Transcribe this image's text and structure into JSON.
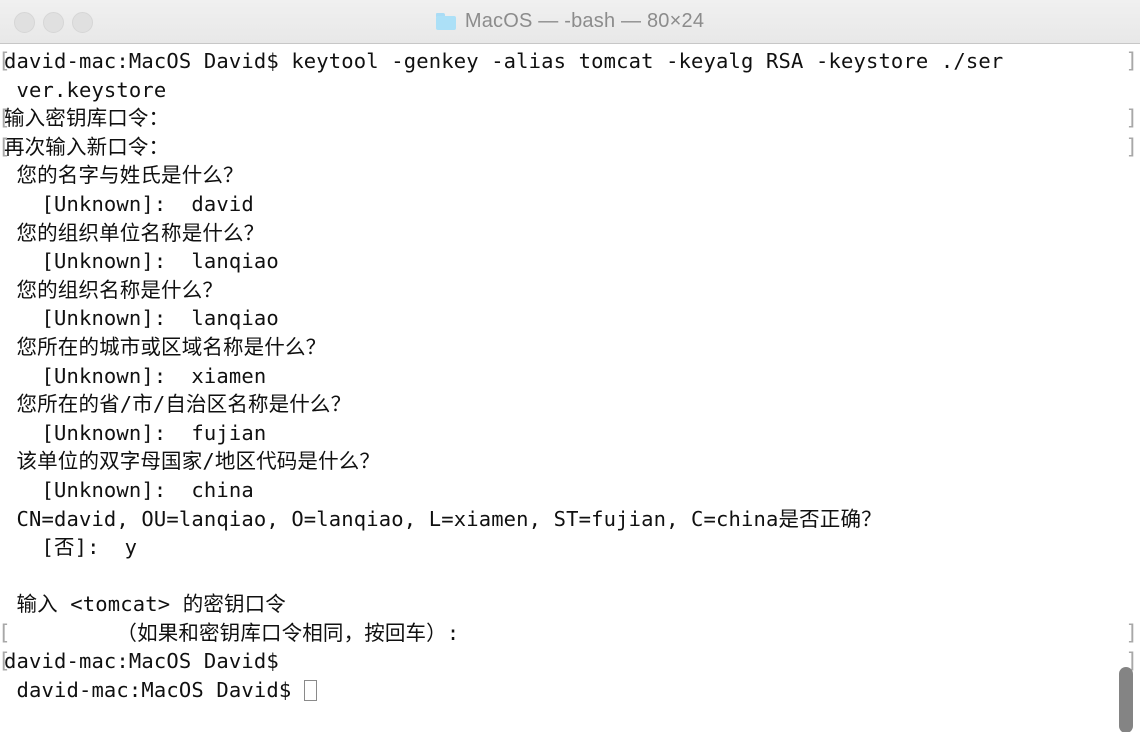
{
  "window": {
    "title": "MacOS — -bash — 80×24",
    "folder_icon": "folder-icon",
    "traffic_lights": [
      {
        "name": "close-button",
        "label": "Close",
        "color": "#e0e0e0"
      },
      {
        "name": "minimize-button",
        "label": "Minimize",
        "color": "#e0e0e0"
      },
      {
        "name": "zoom-button",
        "label": "Zoom",
        "color": "#e0e0e0"
      }
    ],
    "background_color": "#ffffff",
    "text_color": "#101010",
    "titlebar_text_color": "#8c8c8c",
    "scrollbar_color": "#848484"
  },
  "terminal": {
    "cols": 80,
    "rows": 24,
    "shell": "-bash",
    "prompt": "david-mac:MacOS David$",
    "lines": [
      {
        "edge_left": "[",
        "text": "david-mac:MacOS David$ keytool -genkey -alias tomcat -keyalg RSA -keystore ./ser",
        "edge_right": "]"
      },
      {
        "edge_left": "",
        "text": " ver.keystore",
        "edge_right": ""
      },
      {
        "edge_left": "[",
        "text": "输入密钥库口令：  ",
        "edge_right": "]"
      },
      {
        "edge_left": "[",
        "text": "再次输入新口令：  ",
        "edge_right": "]"
      },
      {
        "edge_left": "",
        "text": " 您的名字与姓氏是什么？",
        "edge_right": ""
      },
      {
        "edge_left": "",
        "text": "   [Unknown]:  david",
        "edge_right": ""
      },
      {
        "edge_left": "",
        "text": " 您的组织单位名称是什么？",
        "edge_right": ""
      },
      {
        "edge_left": "",
        "text": "   [Unknown]:  lanqiao",
        "edge_right": ""
      },
      {
        "edge_left": "",
        "text": " 您的组织名称是什么？",
        "edge_right": ""
      },
      {
        "edge_left": "",
        "text": "   [Unknown]:  lanqiao",
        "edge_right": ""
      },
      {
        "edge_left": "",
        "text": " 您所在的城市或区域名称是什么？",
        "edge_right": ""
      },
      {
        "edge_left": "",
        "text": "   [Unknown]:  xiamen",
        "edge_right": ""
      },
      {
        "edge_left": "",
        "text": " 您所在的省/市/自治区名称是什么？",
        "edge_right": ""
      },
      {
        "edge_left": "",
        "text": "   [Unknown]:  fujian",
        "edge_right": ""
      },
      {
        "edge_left": "",
        "text": " 该单位的双字母国家/地区代码是什么？",
        "edge_right": ""
      },
      {
        "edge_left": "",
        "text": "   [Unknown]:  china",
        "edge_right": ""
      },
      {
        "edge_left": "",
        "text": " CN=david, OU=lanqiao, O=lanqiao, L=xiamen, ST=fujian, C=china是否正确？",
        "edge_right": ""
      },
      {
        "edge_left": "",
        "text": "   [否]:  y",
        "edge_right": ""
      },
      {
        "edge_left": "",
        "text": "",
        "edge_right": ""
      },
      {
        "edge_left": "",
        "text": " 输入 <tomcat> 的密钥口令",
        "edge_right": ""
      },
      {
        "edge_left": "[",
        "text": "         （如果和密钥库口令相同，按回车）:  ",
        "edge_right": "]"
      },
      {
        "edge_left": "[",
        "text": "david-mac:MacOS David$ ",
        "edge_right": "]"
      },
      {
        "edge_left": "",
        "text": " david-mac:MacOS David$ ",
        "edge_right": "",
        "cursor": true
      }
    ]
  }
}
